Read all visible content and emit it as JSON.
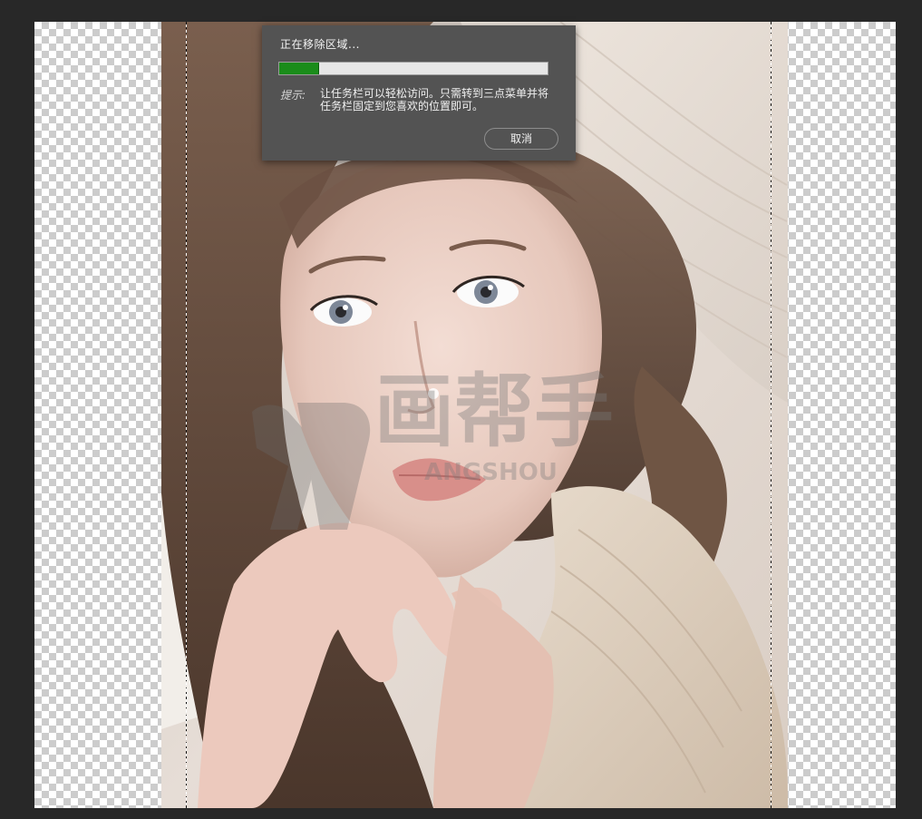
{
  "dialog": {
    "title": "正在移除区域...",
    "progress": 0.15,
    "tip_label": "提示:",
    "tip_text": "让任务栏可以轻松访问。只需转到三点菜单并将任务栏固定到您喜欢的位置即可。",
    "cancel_label": "取消"
  },
  "watermark": {
    "text": "画帮手",
    "subtext": "ANGSHOU"
  },
  "colors": {
    "workspace_bg": "#282828",
    "dialog_bg": "#535353",
    "progress_fill": "#1a8c1a",
    "progress_track": "#e6e6e6"
  }
}
